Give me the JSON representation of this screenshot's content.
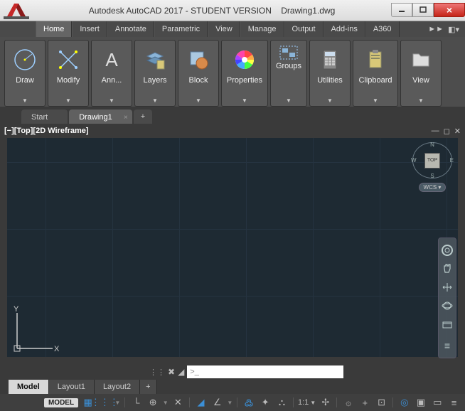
{
  "titlebar": {
    "app_title": "Autodesk AutoCAD 2017 - STUDENT VERSION",
    "file_name": "Drawing1.dwg"
  },
  "menu": {
    "tabs": [
      "Home",
      "Insert",
      "Annotate",
      "Parametric",
      "View",
      "Manage",
      "Output",
      "Add-ins",
      "A360"
    ],
    "active_index": 0
  },
  "ribbon": {
    "panels": [
      {
        "label": "Draw",
        "icon": "circle"
      },
      {
        "label": "Modify",
        "icon": "move"
      },
      {
        "label": "Ann...",
        "icon": "text-a"
      },
      {
        "label": "Layers",
        "icon": "layers"
      },
      {
        "label": "Block",
        "icon": "block"
      },
      {
        "label": "Properties",
        "icon": "colorwheel"
      },
      {
        "label": "Groups",
        "icon": "groups"
      },
      {
        "label": "Utilities",
        "icon": "calculator"
      },
      {
        "label": "Clipboard",
        "icon": "clipboard"
      },
      {
        "label": "View",
        "icon": "folder"
      }
    ]
  },
  "filetabs": {
    "tabs": [
      "Start",
      "Drawing1"
    ],
    "active_index": 1
  },
  "viewport": {
    "label": "[−][Top][2D Wireframe]",
    "cube_face": "TOP",
    "wcs": "WCS",
    "compass": {
      "n": "N",
      "s": "S",
      "e": "E",
      "w": "W"
    }
  },
  "command": {
    "prompt": ">_",
    "value": ""
  },
  "layouttabs": {
    "tabs": [
      "Model",
      "Layout1",
      "Layout2"
    ],
    "active_index": 0
  },
  "statusbar": {
    "model_label": "MODEL",
    "scale": "1:1"
  }
}
